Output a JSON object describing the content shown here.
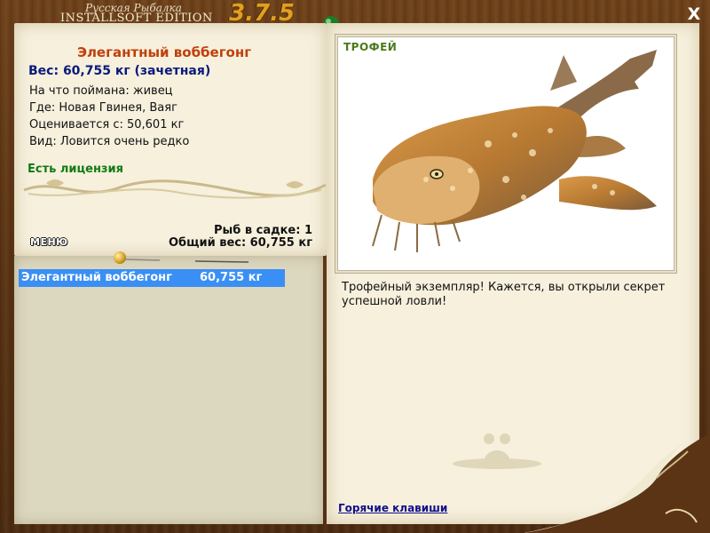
{
  "window": {
    "title_line1": "Русская Рыбалка",
    "title_line2": "INSTALLSOFT EDITION",
    "version": "3.7.5",
    "close_label": "X"
  },
  "fish": {
    "name": "Элегантный воббегонг",
    "weight": "Вес: 60,755 кг (зачетная)",
    "caught_on": "На что поймана: живец",
    "location": "Где: Новая Гвинея, Ваяг",
    "rated_from": "Оценивается с: 50,601 кг",
    "rarity": "Вид: Ловится очень редко"
  },
  "license": "Есть лицензия",
  "keepnet": {
    "count": "Рыб в садке: 1",
    "total": "Общий вес: 60,755 кг"
  },
  "menu_label": "МЕНЮ",
  "catch_list": [
    {
      "name": "Элегантный воббегонг",
      "weight": "60,755 кг",
      "selected": true
    }
  ],
  "photo": {
    "badge": "ТРОФЕЙ"
  },
  "trophy_message": "Трофейный экземпляр! Кажется, вы открыли секрет успешной ловли!",
  "hotkeys_link": "Горячие клавиши",
  "colors": {
    "wood": "#5b3414",
    "parchment": "#f6f0dd",
    "fish_name": "#c0400a",
    "weight": "#0a1a7a",
    "license": "#137a13",
    "selection": "#3a8ff5",
    "link": "#10108a"
  }
}
